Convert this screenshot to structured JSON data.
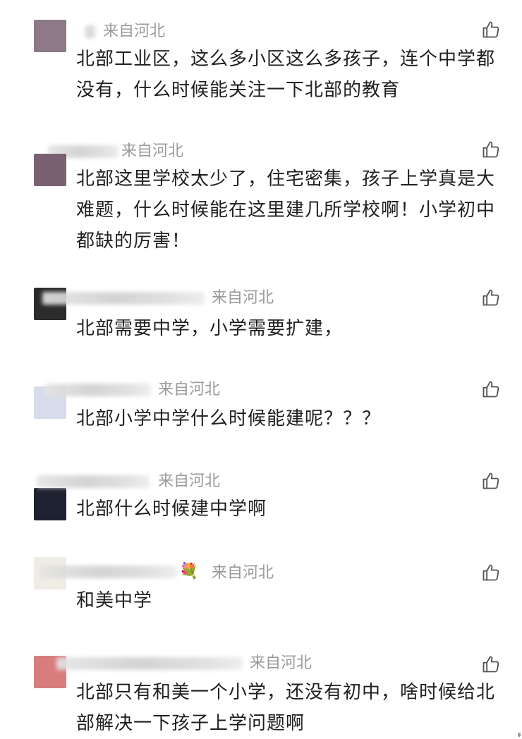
{
  "comments": [
    {
      "location": "来自河北",
      "text": "北部工业区，这么多小区这么多孩子，连个中学都没有，什么时候能关注一下北部的教育",
      "avatar_color": "#8d7a86"
    },
    {
      "location": "来自河北",
      "text": "北部这里学校太少了，住宅密集，孩子上学真是大难题，什么时候能在这里建几所学校啊！小学初中都缺的厉害！",
      "avatar_color": "#7a6172"
    },
    {
      "location": "来自河北",
      "text": "北部需要中学，小学需要扩建，",
      "avatar_color": "#2b2b2b"
    },
    {
      "location": "来自河北",
      "text": "北部小学中学什么时候能建呢？？？",
      "avatar_color": "#d6dcea"
    },
    {
      "location": "来自河北",
      "text": "北部什么时候建中学啊",
      "avatar_color": "#1f2230"
    },
    {
      "location": "来自河北",
      "text": "和美中学",
      "avatar_color": "#f0ece6"
    },
    {
      "location": "来自河北",
      "text": "北部只有和美一个小学，还没有初中，啥时候给北部解决一下孩子上学问题啊",
      "avatar_color": "#d97c7c"
    }
  ],
  "icons": {
    "like": "thumbs-up-icon",
    "flower": "flower-bouquet-icon"
  },
  "flower_glyph": "💐"
}
